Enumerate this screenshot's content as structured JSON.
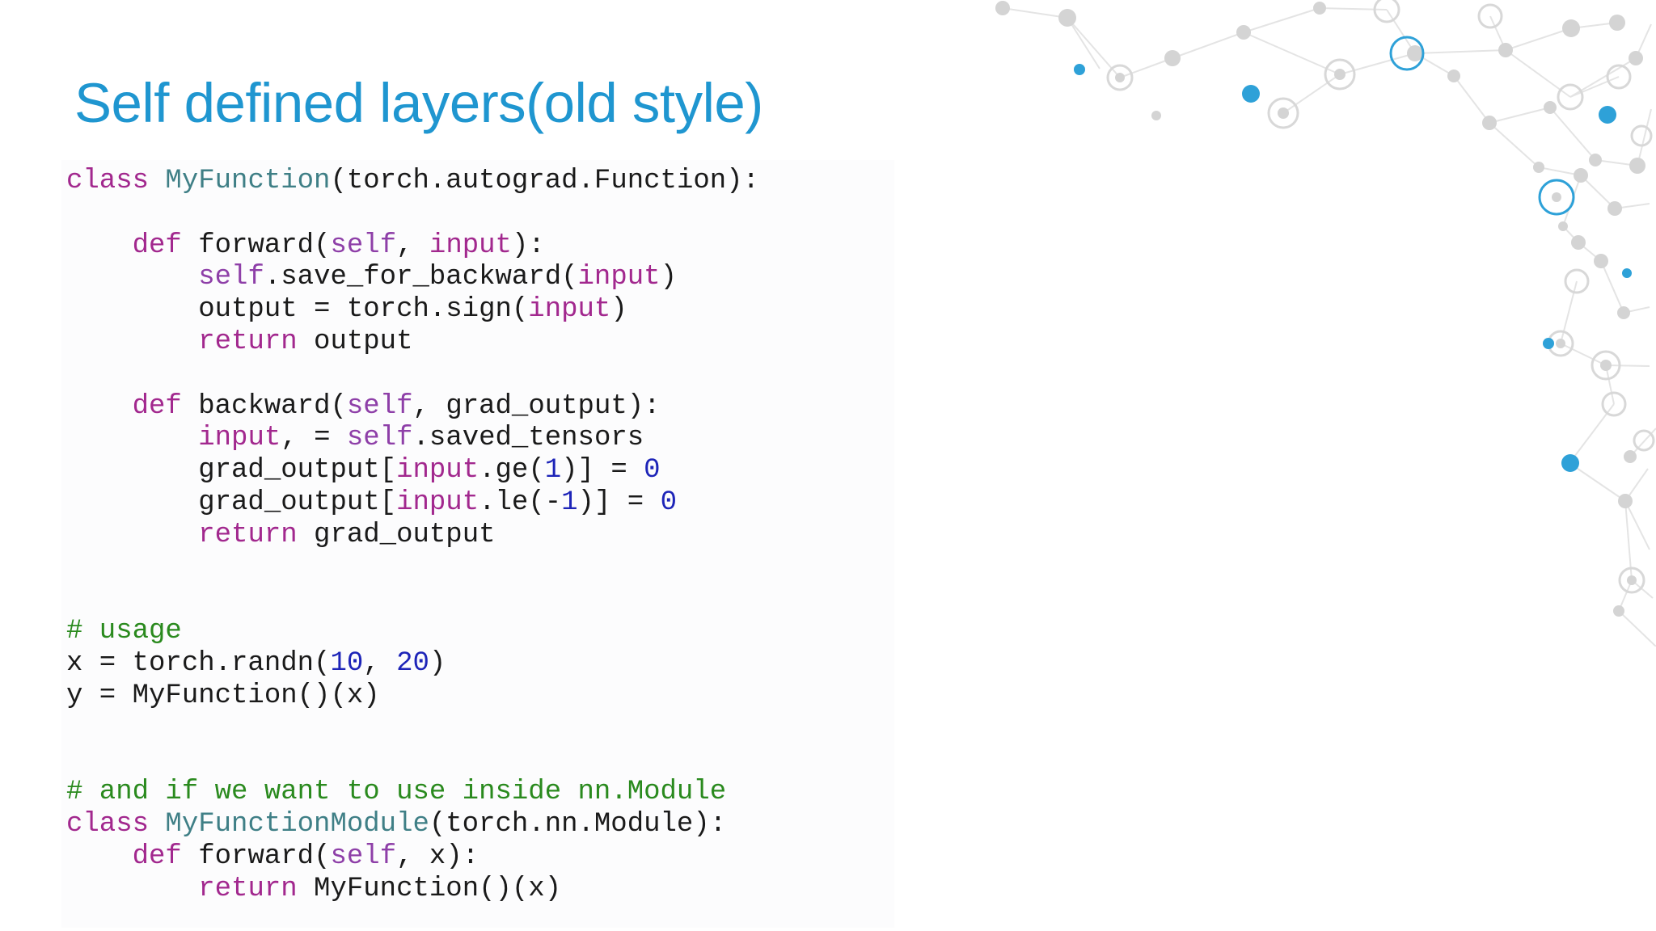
{
  "slide": {
    "title": "Self defined layers(old style)"
  },
  "code": {
    "language": "python",
    "lines": [
      [
        {
          "t": "class ",
          "c": "kw"
        },
        {
          "t": "MyFunction",
          "c": "fn"
        },
        {
          "t": "(torch.autograd.Function):"
        }
      ],
      [],
      [
        {
          "t": "    "
        },
        {
          "t": "def ",
          "c": "kw"
        },
        {
          "t": "forward("
        },
        {
          "t": "self",
          "c": "sf"
        },
        {
          "t": ", "
        },
        {
          "t": "input",
          "c": "kw"
        },
        {
          "t": "):"
        }
      ],
      [
        {
          "t": "        "
        },
        {
          "t": "self",
          "c": "sf"
        },
        {
          "t": ".save_for_backward("
        },
        {
          "t": "input",
          "c": "kw"
        },
        {
          "t": ")"
        }
      ],
      [
        {
          "t": "        output = torch.sign("
        },
        {
          "t": "input",
          "c": "kw"
        },
        {
          "t": ")"
        }
      ],
      [
        {
          "t": "        "
        },
        {
          "t": "return",
          "c": "kw"
        },
        {
          "t": " output"
        }
      ],
      [],
      [
        {
          "t": "    "
        },
        {
          "t": "def ",
          "c": "kw"
        },
        {
          "t": "backward("
        },
        {
          "t": "self",
          "c": "sf"
        },
        {
          "t": ", grad_output):"
        }
      ],
      [
        {
          "t": "        "
        },
        {
          "t": "input",
          "c": "kw"
        },
        {
          "t": ", = "
        },
        {
          "t": "self",
          "c": "sf"
        },
        {
          "t": ".saved_tensors"
        }
      ],
      [
        {
          "t": "        grad_output["
        },
        {
          "t": "input",
          "c": "kw"
        },
        {
          "t": ".ge("
        },
        {
          "t": "1",
          "c": "nu"
        },
        {
          "t": ")] = "
        },
        {
          "t": "0",
          "c": "nu"
        }
      ],
      [
        {
          "t": "        grad_output["
        },
        {
          "t": "input",
          "c": "kw"
        },
        {
          "t": ".le(-"
        },
        {
          "t": "1",
          "c": "nu"
        },
        {
          "t": ")] = "
        },
        {
          "t": "0",
          "c": "nu"
        }
      ],
      [
        {
          "t": "        "
        },
        {
          "t": "return",
          "c": "kw"
        },
        {
          "t": " grad_output"
        }
      ],
      [],
      [],
      [
        {
          "t": "# usage",
          "c": "cm"
        }
      ],
      [
        {
          "t": "x = torch.randn("
        },
        {
          "t": "10",
          "c": "nu"
        },
        {
          "t": ", "
        },
        {
          "t": "20",
          "c": "nu"
        },
        {
          "t": ")"
        }
      ],
      [
        {
          "t": "y = MyFunction()(x)"
        }
      ],
      [],
      [],
      [
        {
          "t": "# and if we want to use inside nn.Module",
          "c": "cm"
        }
      ],
      [
        {
          "t": "class ",
          "c": "kw"
        },
        {
          "t": "MyFunctionModule",
          "c": "fn"
        },
        {
          "t": "(torch.nn.Module):"
        }
      ],
      [
        {
          "t": "    "
        },
        {
          "t": "def ",
          "c": "kw"
        },
        {
          "t": "forward("
        },
        {
          "t": "self",
          "c": "sf"
        },
        {
          "t": ", x):"
        }
      ],
      [
        {
          "t": "        "
        },
        {
          "t": "return",
          "c": "kw"
        },
        {
          "t": " MyFunction()(x)"
        }
      ]
    ]
  },
  "colors": {
    "title": "#1f96d0",
    "keyword": "#a2288e",
    "class_name": "#3f7f86",
    "self": "#8e3fa8",
    "number": "#1d24b8",
    "comment": "#2a8a1e",
    "text": "#1a1a1a",
    "network_accent": "#2ea1d8",
    "network_gray": "#d4d4d4"
  },
  "decoration": {
    "icon": "molecular-network-graphic"
  }
}
